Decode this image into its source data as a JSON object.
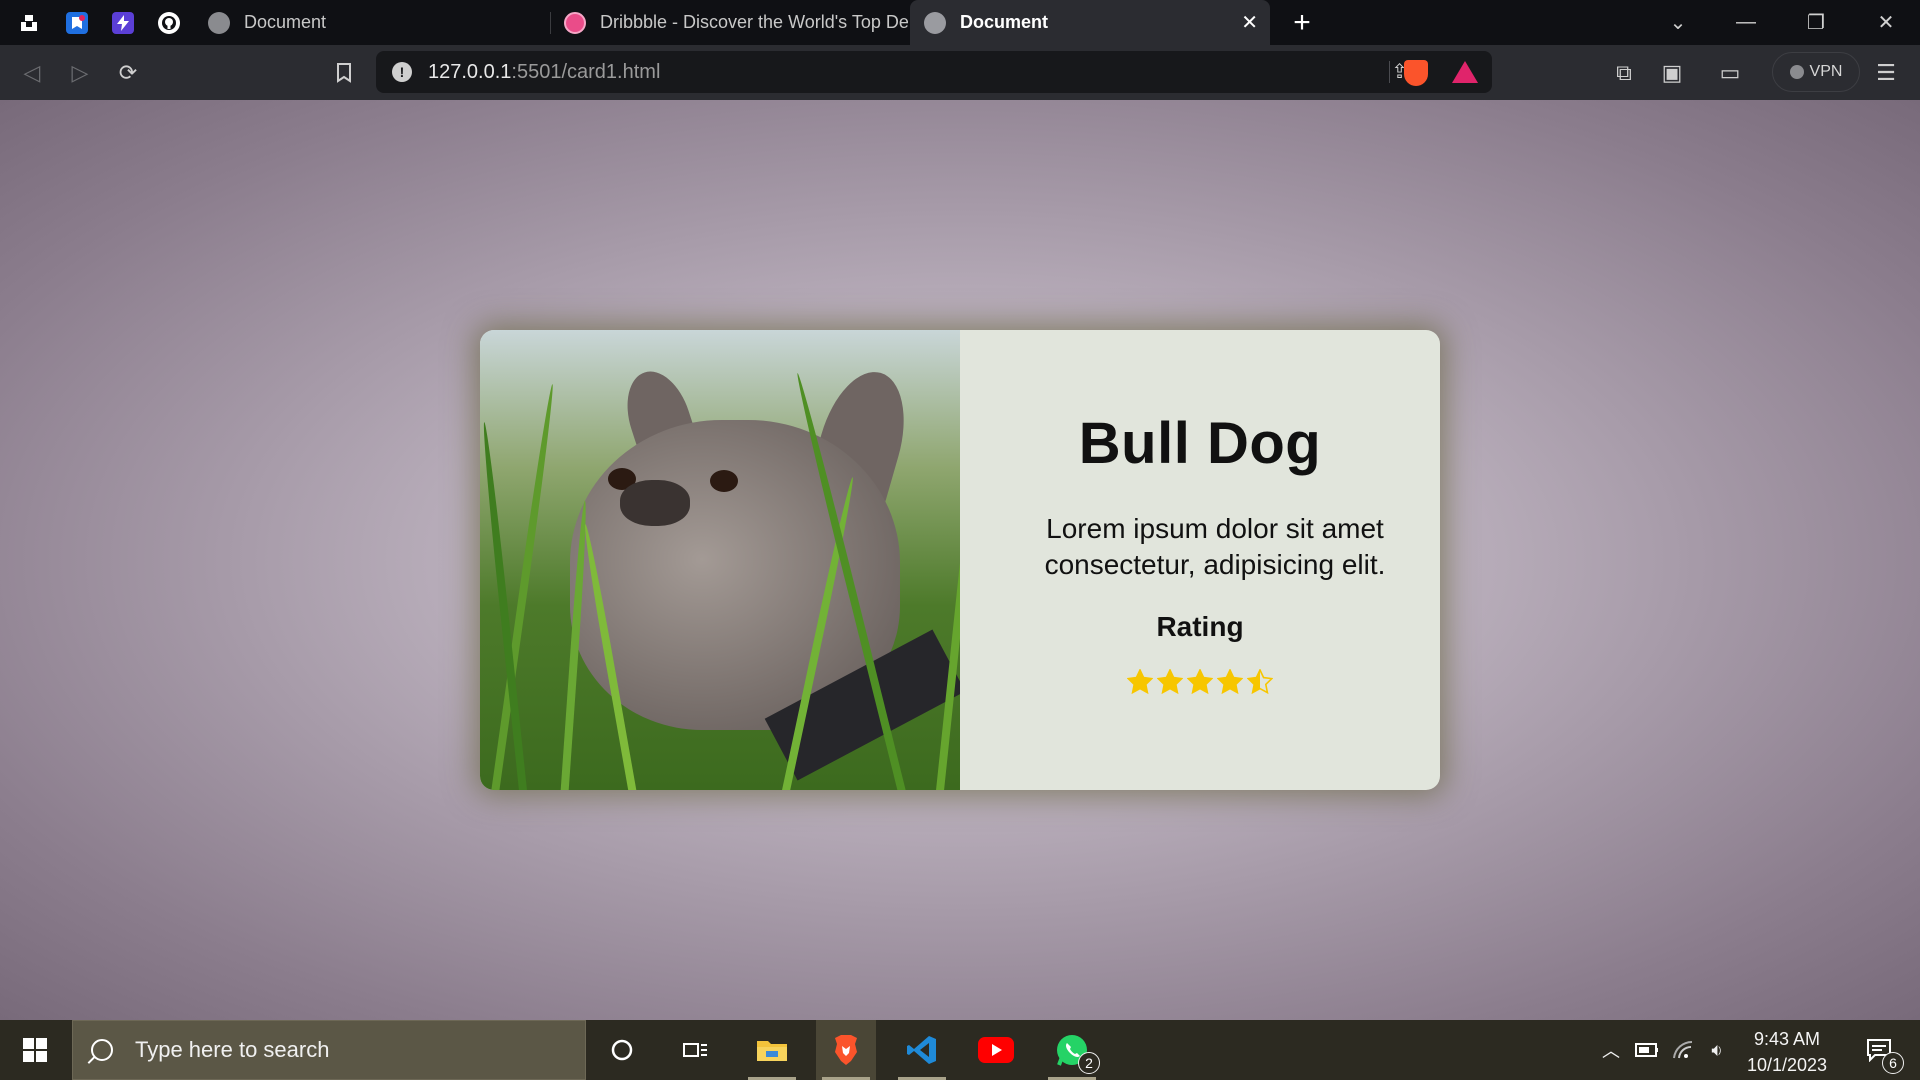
{
  "browser": {
    "pinned_tabs": [
      {
        "icon": "unsplash-icon"
      },
      {
        "icon": "app-bookmark-icon"
      },
      {
        "icon": "bolt-icon"
      },
      {
        "icon": "github-icon"
      }
    ],
    "tabs": [
      {
        "title": "Document",
        "icon": "globe-icon",
        "active": false
      },
      {
        "title": "Dribbble - Discover the World's Top De",
        "icon": "dribbble-icon",
        "active": false
      },
      {
        "title": "Document",
        "icon": "globe-icon",
        "active": true
      }
    ],
    "new_tab": "+",
    "url_host": "127.0.0.1",
    "url_path": ":5501/card1.html",
    "vpn_label": "VPN"
  },
  "card": {
    "title": "Bull Dog",
    "description": "Lorem ipsum dolor sit amet consectetur, adipisicing elit.",
    "subtitle": "Rating",
    "rating": 4.5,
    "rating_max": 5,
    "star_color": "#f7c600"
  },
  "taskbar": {
    "search_placeholder": "Type here to search",
    "apps": [
      "cortana-icon",
      "task-view-icon",
      "file-explorer-icon",
      "brave-icon",
      "vscode-icon",
      "youtube-icon",
      "whatsapp-icon"
    ],
    "whatsapp_badge": "2",
    "time": "9:43 AM",
    "date": "10/1/2023",
    "notification_count": "6"
  },
  "colors": {
    "accent_card": "#e1e5dc",
    "page_bg": "#b5aab7",
    "taskbar": "#2c2a21"
  }
}
